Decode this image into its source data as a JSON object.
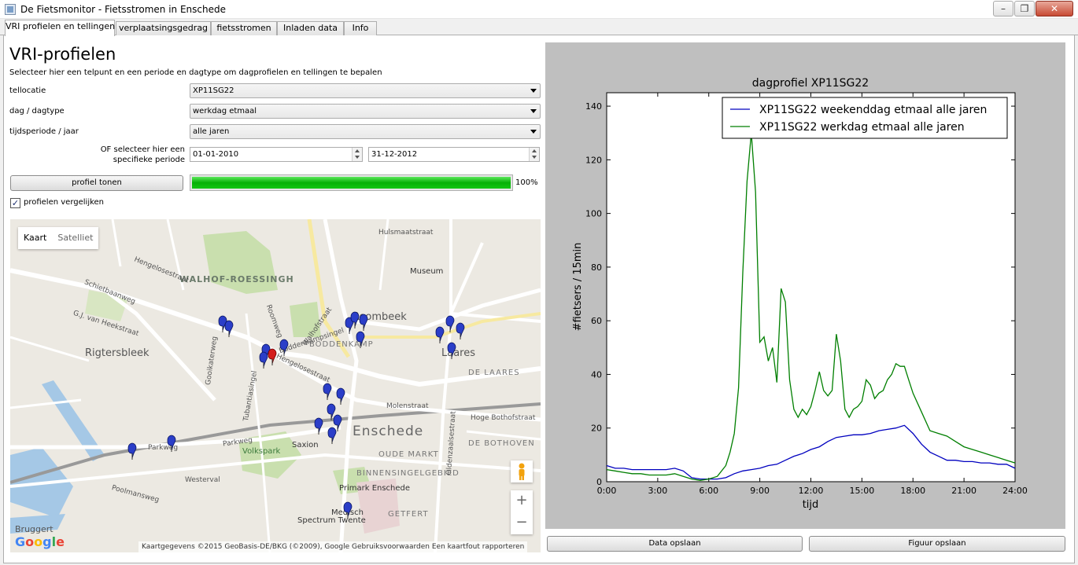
{
  "window": {
    "title": "De Fietsmonitor - Fietsstromen in Enschede",
    "min_icon": "minimize-icon",
    "max_icon": "maximize-icon",
    "close_icon": "close-icon"
  },
  "tabs": [
    {
      "label": "VRI profielen en tellingen",
      "active": true
    },
    {
      "label": "verplaatsingsgedrag"
    },
    {
      "label": "fietsstromen"
    },
    {
      "label": "Inladen data"
    },
    {
      "label": "Info"
    }
  ],
  "form": {
    "title": "VRI-profielen",
    "subtitle": "Selecteer hier een telpunt en een periode en dagtype om dagprofielen en tellingen te bepalen",
    "location_label": "tellocatie",
    "location_value": "XP11SG22",
    "daytype_label": "dag / dagtype",
    "daytype_value": "werkdag etmaal",
    "period_label": "tijdsperiode / jaar",
    "period_value": "alle jaren",
    "custom_period_label_line1": "OF selecteer hier een",
    "custom_period_label_line2": "specifieke periode",
    "start_date": "01-01-2010",
    "end_date": "31-12-2012",
    "show_button": "profiel tonen",
    "progress": 100,
    "progress_text": "100%",
    "compare_label": "profielen vergelijken",
    "compare_checked": "✓"
  },
  "map": {
    "type_map": "Kaart",
    "type_satellite": "Satelliet",
    "zoom_in": "+",
    "zoom_out": "−",
    "logo": "Google",
    "attribution": "Kaartgegevens ©2015 GeoBasis-DE/BKG (©2009), Google   Gebruiksvoorwaarden   Een kaartfout rapporteren",
    "labels": {
      "walhof": "WALHOF-ROESSINGH",
      "roombeek": "Roombeek",
      "rigtersbleek": "Rigtersbleek",
      "boddenkamp": "BODDENKAMP",
      "enschede": "Enschede",
      "laares": "Laares",
      "delaares": "DE LAARES",
      "oude_markt": "OUDE MARKT",
      "binnensingel": "BINNENSINGELGEBIED",
      "debothoven": "DE BOTHOVEN",
      "volkspark": "Volkspark",
      "saxion": "Saxion",
      "primark": "Primark Enschede",
      "medisch": "Medisch",
      "spectrum": "Spectrum Twente",
      "getfert": "GETFERT",
      "museum": "Museum",
      "hulsmaatstraat": "Hulsmaatstraat",
      "hengelosestraat": "Hengelosestraat",
      "hengelosestraat2": "Hengelosestraat",
      "oldenzaalsestraat": "Oldenzaalsestraat",
      "molenstraat": "Molenstraat",
      "parkweg": "Parkweg",
      "parkweg2": "Parkweg",
      "westerval": "Westerval",
      "boddenkampsingel": "Boddenkampsingel",
      "walhofstraat": "Walhofstraat",
      "gj_heekstraat": "G.J. van Heekstraat",
      "schietbaanweg": "Schietbaanweg",
      "poolmansweg": "Poolmansweg",
      "hogebothof": "Hoge Bothofstraat",
      "tubantiasingel": "Tubantiasingel",
      "gooikaterweg": "Gooikaterweg",
      "bruggert": "Bruggert",
      "roomweg": "Roomweg"
    }
  },
  "chart_data": {
    "type": "line",
    "title": "dagprofiel XP11SG22",
    "xlabel": "tijd",
    "ylabel": "#fietsers / 15min",
    "xlim": [
      0,
      24
    ],
    "ylim": [
      0,
      145
    ],
    "xticks": [
      {
        "v": 0,
        "label": "0:00"
      },
      {
        "v": 3,
        "label": "3:00"
      },
      {
        "v": 6,
        "label": "6:00"
      },
      {
        "v": 9,
        "label": "9:00"
      },
      {
        "v": 12,
        "label": "12:00"
      },
      {
        "v": 15,
        "label": "15:00"
      },
      {
        "v": 18,
        "label": "18:00"
      },
      {
        "v": 21,
        "label": "21:00"
      },
      {
        "v": 24,
        "label": "24:00"
      }
    ],
    "yticks": [
      0,
      20,
      40,
      60,
      80,
      100,
      120,
      140
    ],
    "grid": false,
    "legend": "top-right",
    "series": [
      {
        "name": "XP11SG22 weekenddag etmaal alle jaren",
        "color": "#0000bf",
        "x": [
          0,
          0.5,
          1,
          1.5,
          2,
          2.5,
          3,
          3.5,
          4,
          4.5,
          5,
          5.5,
          6,
          6.5,
          7,
          7.5,
          8,
          8.5,
          9,
          9.5,
          10,
          10.5,
          11,
          11.5,
          12,
          12.5,
          13,
          13.5,
          14,
          14.5,
          15,
          15.5,
          16,
          16.5,
          17,
          17.5,
          18,
          18.5,
          19,
          19.5,
          20,
          20.5,
          21,
          21.5,
          22,
          22.5,
          23,
          23.5,
          24
        ],
        "values": [
          6,
          5,
          5,
          4.5,
          4.5,
          4.5,
          4.5,
          4.5,
          5,
          4,
          1.5,
          1,
          1,
          1,
          1.5,
          3,
          4,
          4.5,
          5,
          6,
          6.5,
          8,
          9.5,
          10.5,
          12,
          13,
          15,
          16.5,
          17,
          17.5,
          17.5,
          18,
          19,
          19.5,
          20,
          21,
          18,
          14,
          11,
          9.5,
          8,
          8,
          7.5,
          7.5,
          7,
          7,
          6.5,
          6.5,
          5
        ]
      },
      {
        "name": "XP11SG22 werkdag etmaal alle jaren",
        "color": "#007f00",
        "x": [
          0,
          0.5,
          1,
          1.5,
          2,
          2.5,
          3,
          3.5,
          4,
          4.5,
          5,
          5.5,
          6,
          6.5,
          7,
          7.25,
          7.5,
          7.75,
          8,
          8.25,
          8.5,
          8.75,
          9,
          9.25,
          9.5,
          9.75,
          10,
          10.25,
          10.5,
          10.75,
          11,
          11.25,
          11.5,
          11.75,
          12,
          12.25,
          12.5,
          12.75,
          13,
          13.25,
          13.5,
          13.75,
          14,
          14.25,
          14.5,
          14.75,
          15,
          15.25,
          15.5,
          15.75,
          16,
          16.25,
          16.5,
          16.75,
          17,
          17.25,
          17.5,
          17.75,
          18,
          18.5,
          19,
          19.5,
          20,
          20.5,
          21,
          21.5,
          22,
          22.5,
          23,
          23.5,
          24
        ],
        "values": [
          4.5,
          4,
          3.5,
          3,
          3,
          2.5,
          2.5,
          2.5,
          3,
          2,
          1,
          0.5,
          1,
          2,
          6,
          11,
          18,
          35,
          78,
          112,
          130,
          108,
          52,
          54,
          45,
          50,
          37,
          72,
          67,
          38,
          27,
          24,
          27,
          25,
          28,
          34,
          41,
          34,
          32,
          34,
          55,
          45,
          27,
          24,
          27,
          28,
          30,
          38,
          36,
          31,
          33,
          34,
          38,
          40,
          44,
          43,
          43,
          38,
          33,
          26,
          19,
          18,
          17,
          15,
          13,
          12,
          11,
          10,
          9,
          8,
          7
        ]
      }
    ]
  },
  "buttons": {
    "save_data": "Data opslaan",
    "save_figure": "Figuur opslaan"
  }
}
